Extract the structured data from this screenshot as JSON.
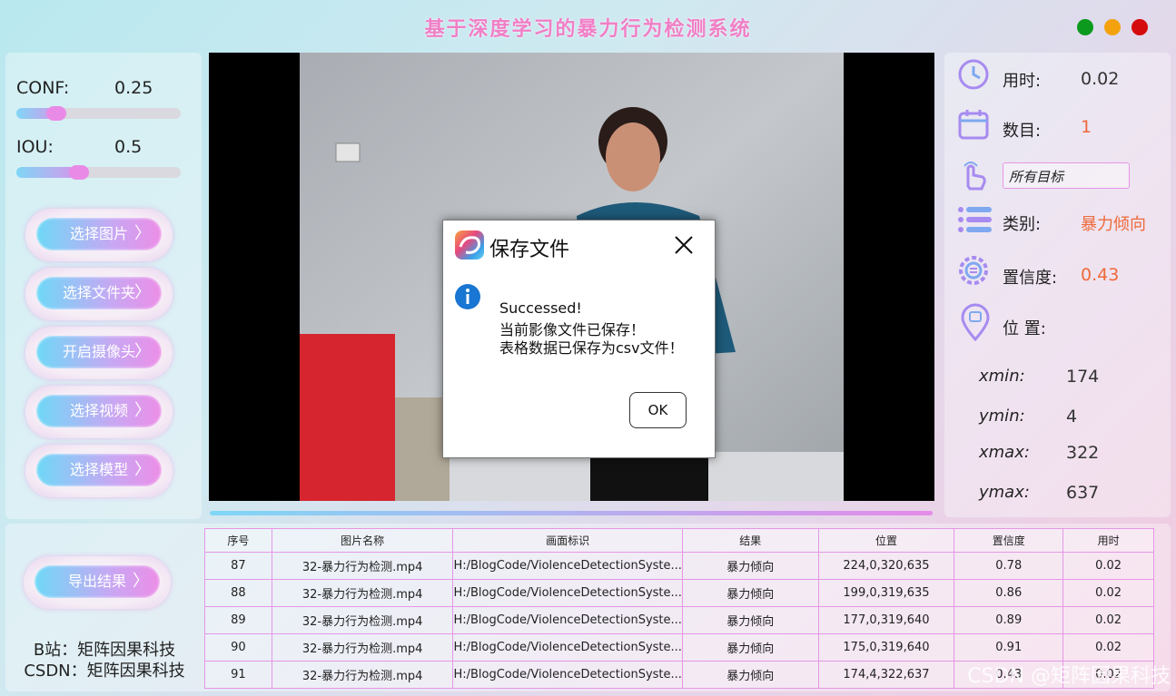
{
  "window": {
    "title": "基于深度学习的暴力行为检测系统",
    "controls": [
      {
        "name": "green",
        "color": "#0b9a1e"
      },
      {
        "name": "orange",
        "color": "#f3a20e"
      },
      {
        "name": "red",
        "color": "#d50c0c"
      }
    ]
  },
  "params": {
    "conf_label": "CONF:",
    "conf_value": "0.25",
    "conf_level": 0.25,
    "iou_label": "IOU:",
    "iou_value": "0.5",
    "iou_level": 0.5
  },
  "buttons": {
    "select_image": "选择图片",
    "select_folder": "选择文件夹",
    "open_camera": "开启摄像头",
    "select_video": "选择视频",
    "select_model": "选择模型",
    "export": "导出结果"
  },
  "info": {
    "time_label": "用时:",
    "time_value": "0.02",
    "count_label": "数目:",
    "count_value": "1",
    "target_select": "所有目标",
    "class_label": "类别:",
    "class_value": "暴力倾向",
    "conf_label": "置信度:",
    "conf_value": "0.43",
    "pos_label": "位 置:",
    "xmin_label": "xmin:",
    "xmin_value": "174",
    "ymin_label": "ymin:",
    "ymin_value": "4",
    "xmax_label": "xmax:",
    "xmax_value": "322",
    "ymax_label": "ymax:",
    "ymax_value": "637"
  },
  "table": {
    "headers": [
      "序号",
      "图片名称",
      "画面标识",
      "结果",
      "位置",
      "置信度",
      "用时"
    ],
    "rows": [
      [
        "87",
        "32-暴力行为检测.mp4",
        "H:/BlogCode/ViolenceDetectionSyste...",
        "暴力倾向",
        "224,0,320,635",
        "0.78",
        "0.02"
      ],
      [
        "88",
        "32-暴力行为检测.mp4",
        "H:/BlogCode/ViolenceDetectionSyste...",
        "暴力倾向",
        "199,0,319,635",
        "0.86",
        "0.02"
      ],
      [
        "89",
        "32-暴力行为检测.mp4",
        "H:/BlogCode/ViolenceDetectionSyste...",
        "暴力倾向",
        "177,0,319,640",
        "0.89",
        "0.02"
      ],
      [
        "90",
        "32-暴力行为检测.mp4",
        "H:/BlogCode/ViolenceDetectionSyste...",
        "暴力倾向",
        "175,0,319,640",
        "0.91",
        "0.02"
      ],
      [
        "91",
        "32-暴力行为检测.mp4",
        "H:/BlogCode/ViolenceDetectionSyste...",
        "暴力倾向",
        "174,4,322,637",
        "0.43",
        "0.02"
      ]
    ]
  },
  "credits": {
    "bilibili": "B站：矩阵因果科技",
    "csdn": "CSDN：矩阵因果科技"
  },
  "dialog": {
    "title": "保存文件",
    "line1": "Successed!",
    "line2": "当前影像文件已保存！",
    "line3": "表格数据已保存为csv文件！",
    "ok": "OK"
  },
  "watermark": "CSDN @矩阵因果科技"
}
